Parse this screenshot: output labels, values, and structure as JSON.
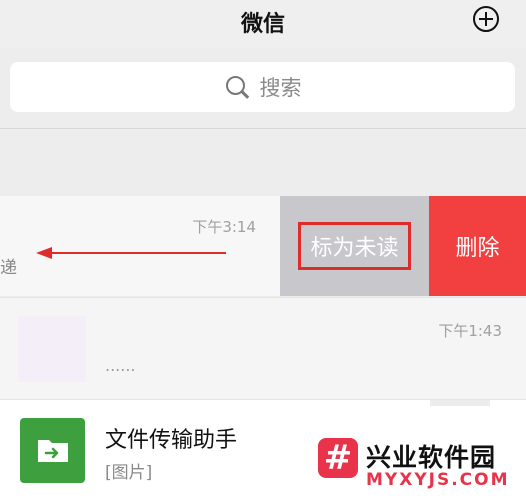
{
  "header": {
    "title": "微信",
    "add_icon": "plus-circle-icon"
  },
  "search": {
    "icon": "search-icon",
    "placeholder": "搜索"
  },
  "chats": [
    {
      "time": "下午3:14",
      "preview": "递"
    },
    {
      "time": "下午1:43",
      "preview": "......"
    },
    {
      "name": "文件传输助手",
      "preview": "[图片]"
    }
  ],
  "swipe_actions": {
    "mark_unread": "标为未读",
    "delete": "删除"
  },
  "colors": {
    "wechat_green": "#3e9f3f",
    "delete_red": "#f24040",
    "unread_gray": "#c8c7cc",
    "highlight_red": "#e02b2b"
  },
  "watermark": {
    "logo_glyph": "#",
    "text_cn": "兴业软件园",
    "text_en": "MYXYJS.COM"
  }
}
